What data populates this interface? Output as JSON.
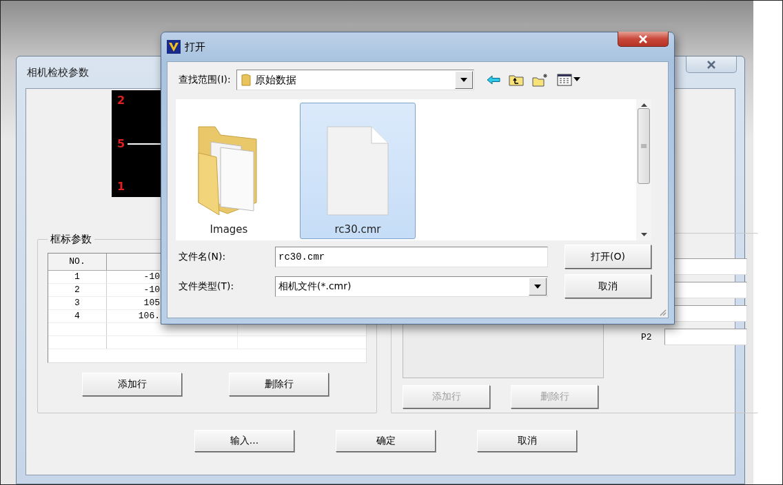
{
  "main_window": {
    "title": "相机检校参数",
    "preview": {
      "labels": [
        "2",
        "5",
        "1"
      ]
    },
    "marker_group": {
      "title": "框标参数",
      "columns": [
        "NO."
      ],
      "rows": [
        [
          "1",
          "-10"
        ],
        [
          "2",
          "-10"
        ],
        [
          "3",
          "105"
        ],
        [
          "4",
          "106."
        ]
      ],
      "buttons": [
        {
          "label": "添加行",
          "disabled": false
        },
        {
          "label": "删除行",
          "disabled": false
        }
      ]
    },
    "right_group": {
      "fields": [
        {
          "label": "P2"
        }
      ],
      "buttons": [
        {
          "label": "添加行",
          "disabled": true
        },
        {
          "label": "删除行",
          "disabled": true
        }
      ]
    },
    "buttons": [
      "输入...",
      "确定",
      "取消"
    ]
  },
  "open_dialog": {
    "title": "打开",
    "look_in_label": "查找范围(I):",
    "look_in_value": "原始数据",
    "files": [
      {
        "name": "Images",
        "kind": "folder",
        "selected": false
      },
      {
        "name": "rc30.cmr",
        "kind": "file",
        "selected": true
      }
    ],
    "file_name_label": "文件名(N):",
    "file_name_value": "rc30.cmr",
    "file_type_label": "文件类型(T):",
    "file_type_value": "相机文件(*.cmr)",
    "buttons": [
      "打开(O)",
      "取消"
    ]
  }
}
